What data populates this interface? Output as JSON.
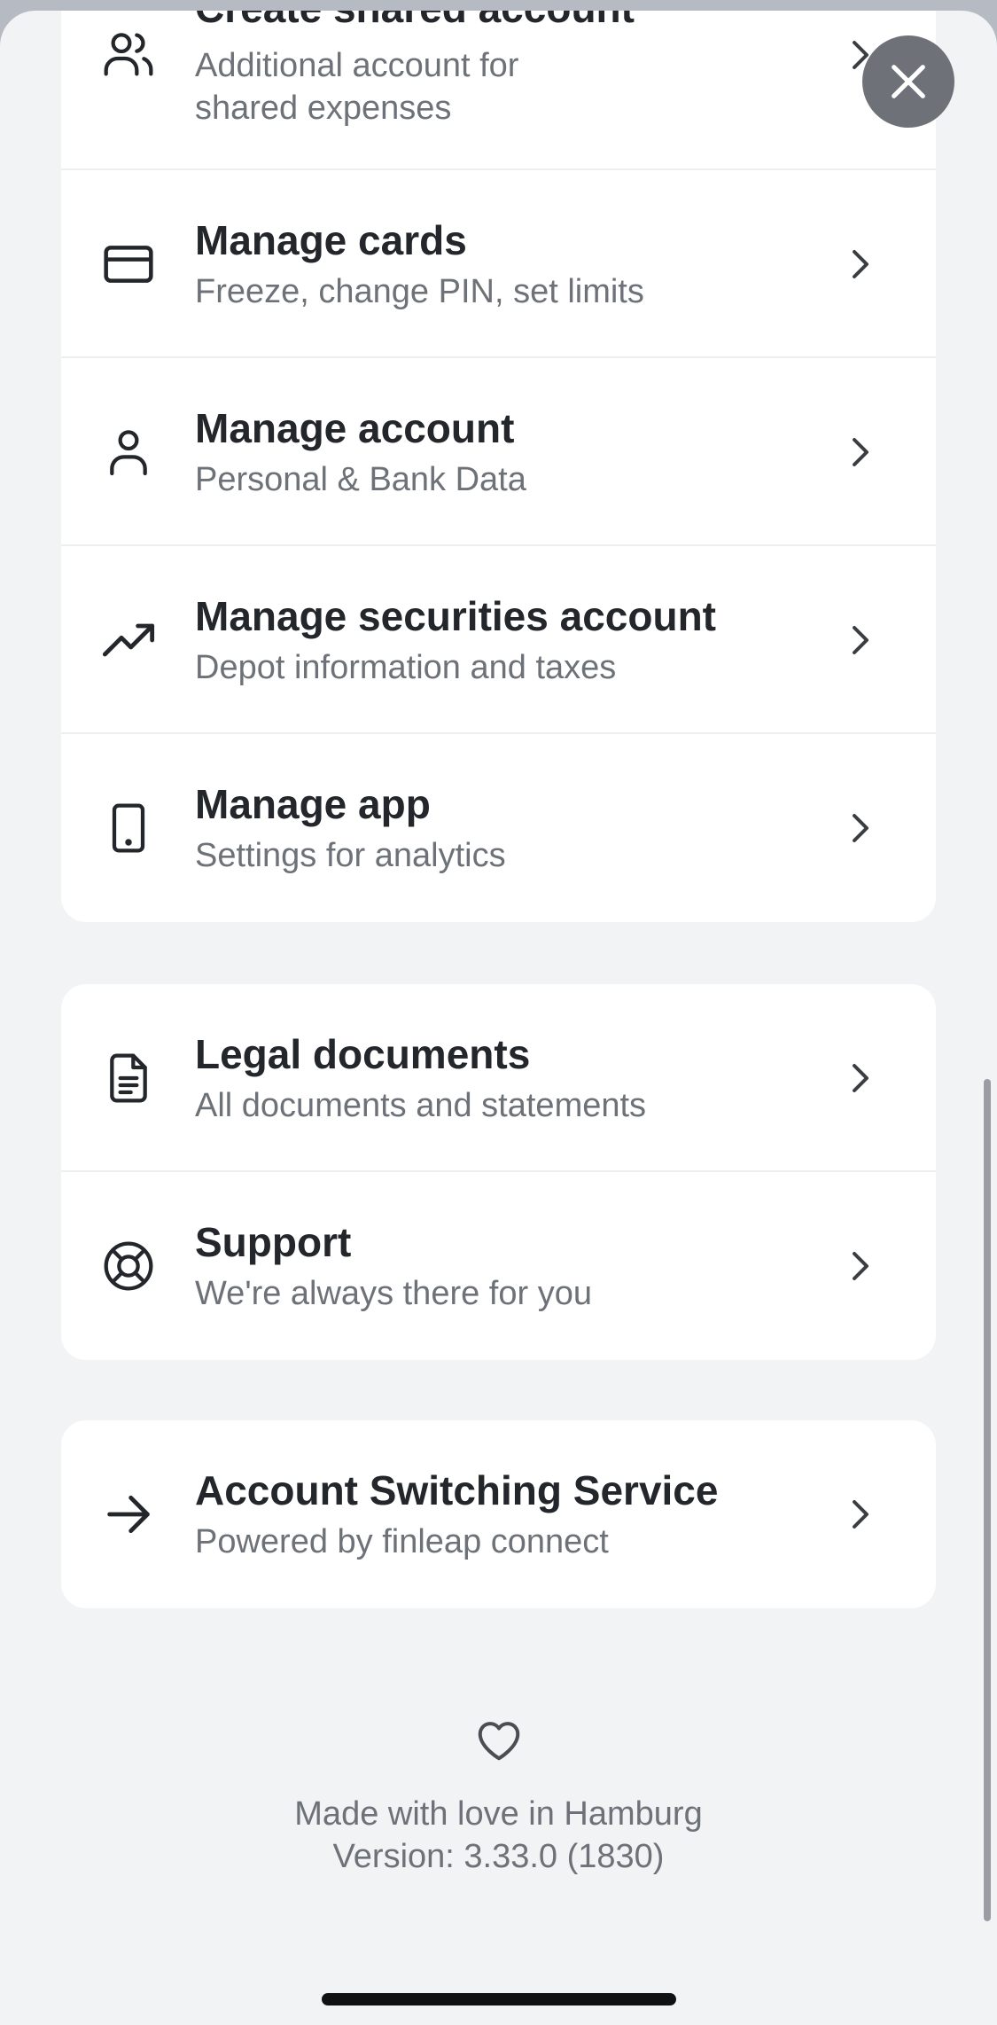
{
  "menu_group_1": {
    "items": [
      {
        "title": "Create shared account",
        "subtitle": "Additional account for shared expenses",
        "icon": "users-icon"
      },
      {
        "title": "Manage cards",
        "subtitle": "Freeze, change PIN, set limits",
        "icon": "credit-card-icon"
      },
      {
        "title": "Manage account",
        "subtitle": "Personal & Bank Data",
        "icon": "user-icon"
      },
      {
        "title": "Manage securities account",
        "subtitle": "Depot information and taxes",
        "icon": "trending-up-icon"
      },
      {
        "title": "Manage app",
        "subtitle": "Settings for analytics",
        "icon": "smartphone-icon"
      }
    ]
  },
  "menu_group_2": {
    "items": [
      {
        "title": "Legal documents",
        "subtitle": "All documents and statements",
        "icon": "document-icon"
      },
      {
        "title": "Support",
        "subtitle": "We're always there for you",
        "icon": "lifebuoy-icon"
      }
    ]
  },
  "menu_group_3": {
    "items": [
      {
        "title": "Account Switching Service",
        "subtitle": "Powered by finleap connect",
        "icon": "arrow-right-icon"
      }
    ]
  },
  "footer": {
    "tagline": "Made with love in Hamburg",
    "version": "Version: 3.33.0 (1830)",
    "icon": "heart-icon"
  },
  "close_button": {
    "icon": "close-icon"
  },
  "colors": {
    "background": "#f1f3f5",
    "card": "#ffffff",
    "text_primary": "#23262b",
    "text_secondary": "#6d7178",
    "close_button": "#6e7177"
  }
}
